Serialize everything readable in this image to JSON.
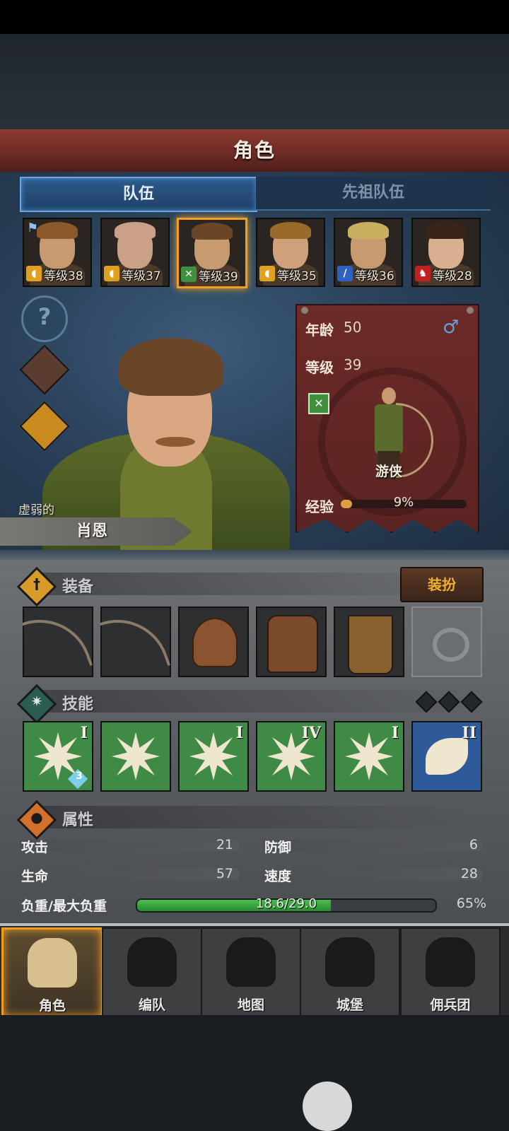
{
  "header": {
    "title": "角色"
  },
  "tabs": [
    {
      "label": "队伍",
      "active": true
    },
    {
      "label": "先祖队伍",
      "active": false
    }
  ],
  "roster": [
    {
      "level_text": "等级38",
      "class_icon": "shield-icon",
      "class_color": "#e0a020",
      "hair": "#8a5a2a",
      "skin": "#c79a70",
      "leader": true
    },
    {
      "level_text": "等级37",
      "class_icon": "shield-icon",
      "class_color": "#e0a020",
      "hair": "#c9a088",
      "skin": "#c9a088",
      "leader": false
    },
    {
      "level_text": "等级39",
      "class_icon": "bow-x-icon",
      "class_color": "#3f8f3c",
      "hair": "#6b4528",
      "skin": "#c79a70",
      "leader": false,
      "selected": true
    },
    {
      "level_text": "等级35",
      "class_icon": "shield-icon",
      "class_color": "#e0a020",
      "hair": "#9a6a2a",
      "skin": "#d0a07a",
      "leader": false
    },
    {
      "level_text": "等级36",
      "class_icon": "sword-icon",
      "class_color": "#3060c0",
      "hair": "#c8b060",
      "skin": "#c79a70",
      "leader": false
    },
    {
      "level_text": "等级28",
      "class_icon": "beast-icon",
      "class_color": "#c02020",
      "hair": "#3a2418",
      "skin": "#d8b090",
      "leader": false
    }
  ],
  "character": {
    "trait": "虚弱的",
    "name": "肖恩",
    "age_label": "年龄",
    "age": "50",
    "level_label": "等级",
    "level": "39",
    "gender_icon": "male-icon",
    "class_name": "游侠",
    "exp_label": "经验",
    "exp_text": "9%",
    "exp_fraction": 0.09
  },
  "equipment": {
    "title": "装备",
    "dress_button": "装扮",
    "slots": [
      "bow-icon",
      "bow-icon",
      "helmet-icon",
      "armor-icon",
      "boots-icon",
      "ring-icon"
    ]
  },
  "skills": {
    "title": "技能",
    "items": [
      {
        "rank": "I",
        "icon": "burst-sword-icon",
        "badge": "3",
        "color": "green"
      },
      {
        "rank": "",
        "icon": "burst-arrow-icon",
        "color": "green"
      },
      {
        "rank": "I",
        "icon": "burst-crystal-icon",
        "color": "green"
      },
      {
        "rank": "IV",
        "icon": "burst-icon",
        "color": "green"
      },
      {
        "rank": "I",
        "icon": "burst-small-icon",
        "color": "green"
      },
      {
        "rank": "II",
        "icon": "wing-icon",
        "color": "blue"
      }
    ]
  },
  "attributes": {
    "title": "属性",
    "attack_label": "攻击",
    "attack": "21",
    "defense_label": "防御",
    "defense": "6",
    "hp_label": "生命",
    "hp": "57",
    "speed_label": "速度",
    "speed": "28",
    "weight_label": "负重/最大负重",
    "weight_text": "18.6/29.0",
    "weight_pct": "65%",
    "weight_fraction": 0.65
  },
  "nav": [
    {
      "label": "角色",
      "icon": "knight-icon",
      "active": true
    },
    {
      "label": "编队",
      "icon": "helmet-icon",
      "active": false
    },
    {
      "label": "地图",
      "icon": "compass-icon",
      "active": false
    },
    {
      "label": "城堡",
      "icon": "castle-icon",
      "active": false
    },
    {
      "label": "佣兵团",
      "icon": "mercenary-icon",
      "active": false
    }
  ]
}
